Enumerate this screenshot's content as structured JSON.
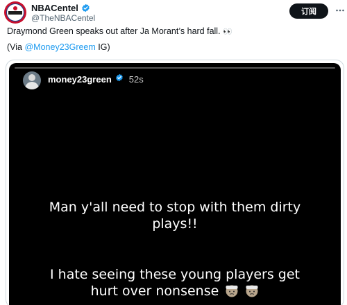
{
  "author": {
    "display_name": "NBACentel",
    "handle": "@TheNBACentel",
    "avatar_icon": "nba-centel-logo-icon",
    "verified_icon": "verified-badge-icon"
  },
  "subscribe_button": {
    "label": "订阅"
  },
  "more_icon": "more-dots-icon",
  "tweet": {
    "text_main": "Draymond Green speaks out after Ja Morant’s hard fall.",
    "eyes_emoji": "👀",
    "via_prefix": "(Via ",
    "via_mention": "@Money23Greem",
    "via_suffix": " IG)"
  },
  "story": {
    "username": "money23green",
    "time": "52s",
    "progress": 0.0,
    "caption_1_line_1": "Man y'all need to stop with them dirty",
    "caption_1_line_2": "plays!!",
    "caption_2_line_1": "I hate seeing these young players get",
    "caption_2_line_2": "hurt over nonsense",
    "caption_2_emoji_icons": [
      "face-with-head-bandage-icon",
      "face-with-head-bandage-icon"
    ]
  },
  "colors": {
    "accent_link": "#1d9bf0",
    "verified_blue": "#1d9bf0",
    "story_background": "#000000",
    "subscribe_background": "#0f1419"
  }
}
